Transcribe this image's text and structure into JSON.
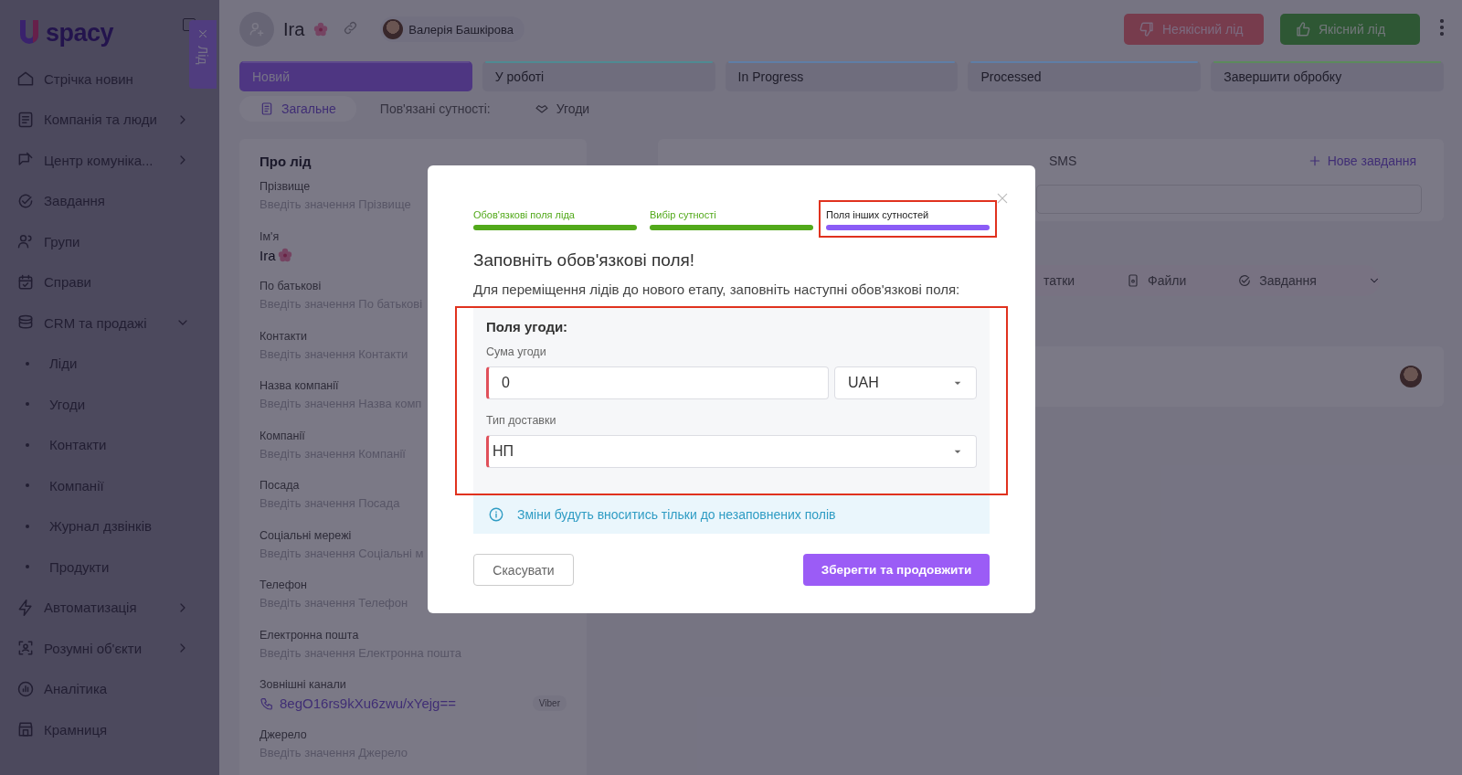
{
  "sidebar": {
    "logo": "spacy",
    "items": [
      {
        "label": "Стрічка новин",
        "kind": "link"
      },
      {
        "label": "Компанія та люди",
        "kind": "group",
        "expanded": false
      },
      {
        "label": "Центр комуніка...",
        "kind": "group",
        "expanded": false
      },
      {
        "label": "Завдання",
        "kind": "link"
      },
      {
        "label": "Групи",
        "kind": "link"
      },
      {
        "label": "Справи",
        "kind": "link"
      },
      {
        "label": "CRM та продажі",
        "kind": "group",
        "expanded": true
      },
      {
        "label": "Ліди",
        "kind": "sub"
      },
      {
        "label": "Угоди",
        "kind": "sub"
      },
      {
        "label": "Контакти",
        "kind": "sub"
      },
      {
        "label": "Компанії",
        "kind": "sub"
      },
      {
        "label": "Журнал дзвінків",
        "kind": "sub"
      },
      {
        "label": "Продукти",
        "kind": "sub"
      },
      {
        "label": "Автоматизація",
        "kind": "group",
        "expanded": false
      },
      {
        "label": "Розумні об'єкти",
        "kind": "group",
        "expanded": false
      },
      {
        "label": "Аналітика",
        "kind": "link"
      },
      {
        "label": "Крамниця",
        "kind": "link"
      }
    ]
  },
  "side_tab": {
    "label": "Лід"
  },
  "header": {
    "title": "Ira",
    "responsible": "Валерія Башкірова",
    "buttons": [
      {
        "label": "Неякісний лід",
        "kind": "bad"
      },
      {
        "label": "Якісний лід",
        "kind": "good"
      }
    ]
  },
  "stages": [
    {
      "label": "Новий",
      "selected": true,
      "color": "#5e4a8c"
    },
    {
      "label": "У роботі",
      "selected": false,
      "color": "#4f8a92"
    },
    {
      "label": "In Progress",
      "selected": false,
      "color": "#5f7ea6"
    },
    {
      "label": "Processed",
      "selected": false,
      "color": "#5f7ea6"
    },
    {
      "label": "Завершити обробку",
      "selected": false,
      "color": "#5c8a5c"
    }
  ],
  "tabs": [
    {
      "label": "Загальне",
      "selected": true,
      "kind": "tab"
    },
    {
      "label": "Пов'язані сутності:",
      "kind": "label"
    },
    {
      "label": "Угоди",
      "selected": false,
      "kind": "tab"
    }
  ],
  "lead_card": {
    "title": "Про лід",
    "fields": [
      {
        "label": "Прізвище",
        "placeholder": "Введіть значення Прізвище"
      },
      {
        "label": "Ім'я",
        "value": "Ira"
      },
      {
        "label": "По батькові",
        "placeholder": "Введіть значення По батькові"
      },
      {
        "label": "Контакти",
        "placeholder": "Введіть значення Контакти"
      },
      {
        "label": "Назва компанії",
        "placeholder": "Введіть значення Назва комп"
      },
      {
        "label": "Компанії",
        "placeholder": "Введіть значення Компанії"
      },
      {
        "label": "Посада",
        "placeholder": "Введіть значення Посада"
      },
      {
        "label": "Соціальні мережі",
        "placeholder": "Введіть значення Соціальні м"
      },
      {
        "label": "Телефон",
        "placeholder": "Введіть значення Телефон"
      },
      {
        "label": "Електронна пошта",
        "placeholder": "Введіть значення Електронна пошта"
      },
      {
        "label": "Зовнішні канали",
        "link": "8egO16rs9kXu6zwu/xYejg==",
        "badge": "Viber"
      },
      {
        "label": "Джерело",
        "placeholder": "Введіть значення Джерело"
      }
    ]
  },
  "activity": {
    "tab": "SMS",
    "new_task": "Нове завдання",
    "filters": [
      "татки",
      "Файли",
      "Завдання"
    ]
  },
  "dialog": {
    "steps": [
      {
        "label": "Обов'язкові поля ліда",
        "done": true
      },
      {
        "label": "Вибір сутності",
        "done": true
      },
      {
        "label": "Поля інших сутностей",
        "done": false
      }
    ],
    "heading": "Заповніть обов'язкові поля!",
    "text": "Для переміщення лідів до нового етапу, заповніть наступні обов'язкові поля:",
    "section": {
      "title": "Поля угоди:",
      "fields": [
        {
          "label": "Сума угоди",
          "value": "0",
          "required": true,
          "currency": "UAH"
        },
        {
          "label": "Тип доставки",
          "value": "НП",
          "required": true
        }
      ]
    },
    "info": "Зміни будуть вноситись тільки до незаповнених полів",
    "cancel": "Скасувати",
    "confirm": "Зберегти та продовжити"
  }
}
